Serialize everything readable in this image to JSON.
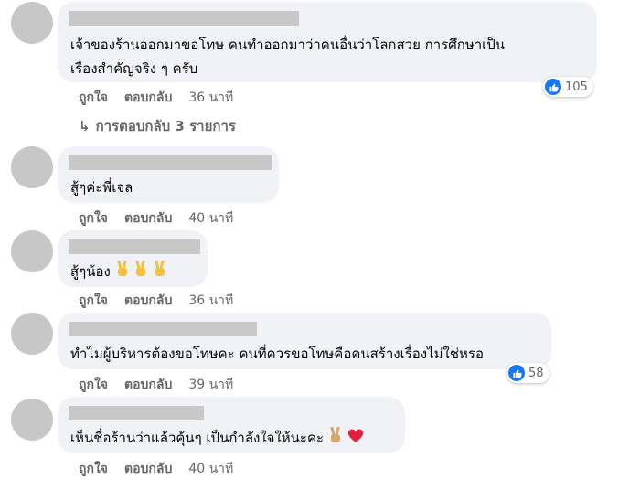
{
  "comments": [
    {
      "text_lines": [
        "เจ้าของร้านออกมาขอโทษ คนทำออกมาว่าคนอื่นว่าโลกสวย การศึกษาเป็น",
        "เรื่องสำคัญจริง ๆ ครับ"
      ],
      "like_label": "ถูกใจ",
      "reply_label": "ตอบกลับ",
      "time": "36 นาที",
      "reaction_count": "105",
      "replies_label": "การตอบกลับ 3 รายการ"
    },
    {
      "text_lines": [
        "สู้ๆค่ะพี่เจล"
      ],
      "like_label": "ถูกใจ",
      "reply_label": "ตอบกลับ",
      "time": "40 นาที"
    },
    {
      "text_lines": [
        "สู้ๆน้อง"
      ],
      "like_label": "ถูกใจ",
      "reply_label": "ตอบกลับ",
      "time": "36 นาที",
      "emoji": [
        "victory-hand",
        "victory-hand",
        "victory-hand"
      ]
    },
    {
      "text_lines": [
        "ทำไมผู้บริหารต้องขอโทษคะ คนที่ควรขอโทษคือคนสร้างเรื่องไม่ใช่หรอ"
      ],
      "like_label": "ถูกใจ",
      "reply_label": "ตอบกลับ",
      "time": "39 นาที",
      "reaction_count": "58"
    },
    {
      "text_lines": [
        "เห็นชื่อร้านว่าแล้วคุ้นๆ เป็นกำลังใจให้นะคะ"
      ],
      "like_label": "ถูกใจ",
      "reply_label": "ตอบกลับ",
      "time": "40 นาที",
      "emoji": [
        "victory-hand",
        "red-heart"
      ]
    }
  ],
  "colors": {
    "bubble": "#f0f2f5",
    "avatar": "#c7c7c7",
    "name_placeholder": "#c8c8c8",
    "meta_text": "#65676b",
    "like_blue": "#1877f2",
    "heart_red": "#e41e3f",
    "victory_yellow": "#f5c33b"
  }
}
